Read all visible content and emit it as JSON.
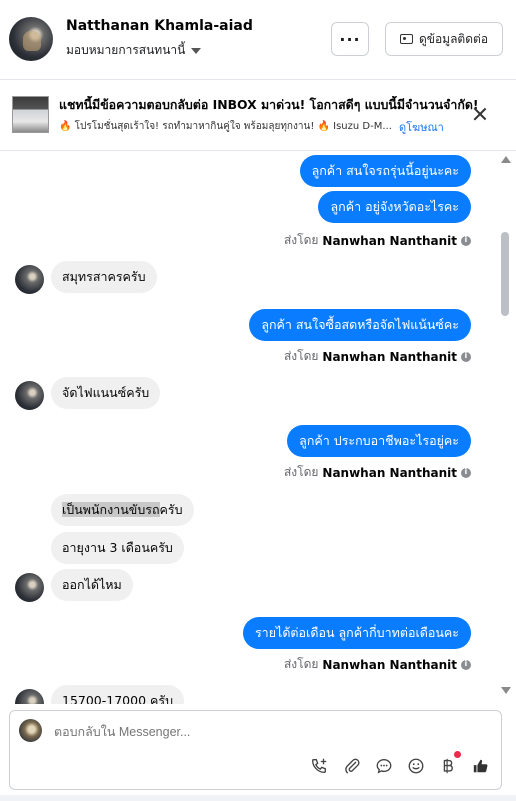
{
  "header": {
    "contact_name": "Natthanan Khamla-aiad",
    "assignment": "มอบหมายการสนทนานี้",
    "more_label": "···",
    "info_button_label": "ดูข้อมูลติดต่อ"
  },
  "ad": {
    "title": "แชทนี้มีข้อความตอบกลับต่อ INBOX มาด่วน! โอกาสดีๆ แบบนี้มีจำนวนจำกัด!",
    "description": "🔥 โปรโมชั่นสุดเร้าใจ! รถทำมาหากินคู่ใจ พร้อมลุยทุกงาน! 🔥 Isuzu D-M...",
    "link_label": "ดูโฆษณา"
  },
  "messages": {
    "out_1": "ลูกค้า สนใจรถรุ่นนี้อยู่นะคะ",
    "out_2": "ลูกค้า อยู่จังหวัดอะไรคะ",
    "in_1": "สมุทรสาครครับ",
    "out_3": "ลูกค้า สนใจซื้อสดหรือจัดไฟแน้นซ์คะ",
    "in_2": "จัดไฟแนนซ์ครับ",
    "out_4": "ลูกค้า ประกบอาชีพอะไรอยู่คะ",
    "in_3_highlight": "เป็นพนักงานขับรถ",
    "in_3_rest": "ครับ",
    "in_4": "อายุงาน 3 เดือนครับ",
    "in_5": "ออกได้ไหม",
    "out_5": "รายได้ต่อเดือน ลูกค้ากี่บาทต่อเดือนคะ",
    "in_6_partial": "15700-17000 ครับ"
  },
  "sent_by": {
    "prefix": "ส่งโดย",
    "agent": "Nanwhan Nanthanit"
  },
  "composer": {
    "placeholder": "ตอบกลับใน Messenger..."
  },
  "colors": {
    "outgoing_bubble": "#0a7cff",
    "incoming_bubble": "#f0f0f0",
    "link": "#1877f2",
    "notification_dot": "#f02849"
  }
}
